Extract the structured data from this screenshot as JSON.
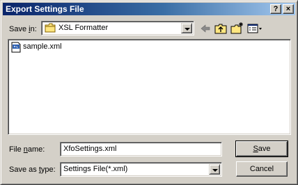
{
  "window": {
    "title": "Export Settings File"
  },
  "titlebar_buttons": {
    "help": "?",
    "close": "×"
  },
  "save_in": {
    "label_pre": "Save ",
    "label_key": "i",
    "label_post": "n:",
    "value": "XSL Formatter"
  },
  "files": [
    {
      "name": "sample.xml"
    }
  ],
  "filename": {
    "label_pre": "File ",
    "label_key": "n",
    "label_post": "ame:",
    "value": "XfoSettings.xml"
  },
  "save_type": {
    "label_pre": "Save as ",
    "label_key": "t",
    "label_post": "ype:",
    "value": "Settings File(*.xml)"
  },
  "buttons": {
    "save_key": "S",
    "save_rest": "ave",
    "cancel": "Cancel"
  },
  "icons": {
    "folder": "folder-icon",
    "back": "back-arrow-icon",
    "up": "up-folder-icon",
    "new_folder": "new-folder-icon",
    "views": "views-menu-icon",
    "xml_file": "xml-file-icon"
  }
}
